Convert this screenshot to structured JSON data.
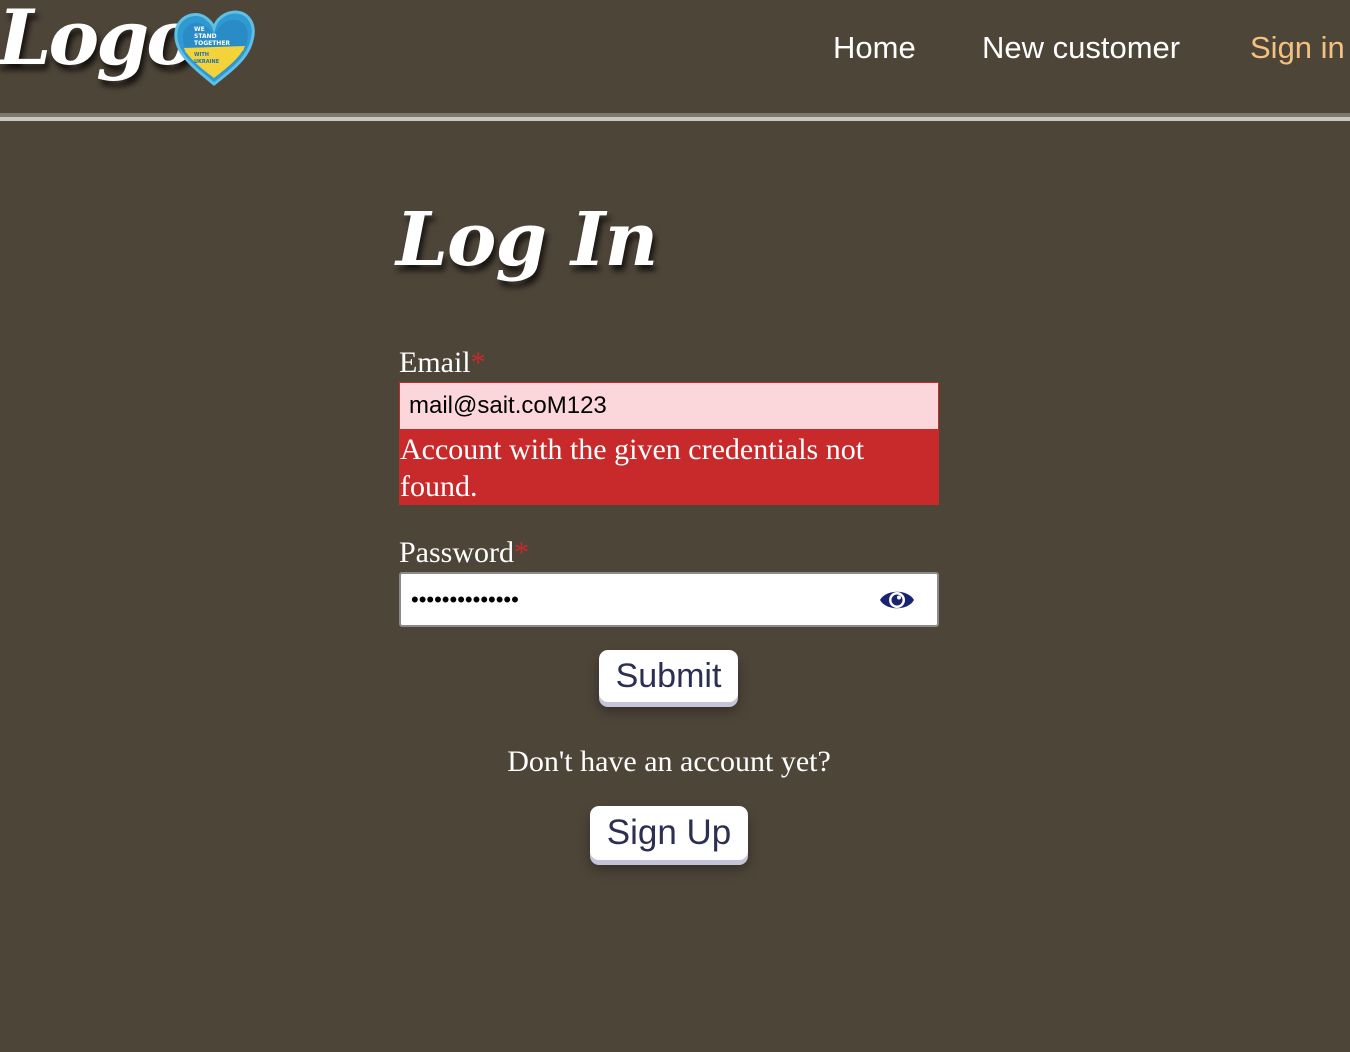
{
  "header": {
    "logo_text": "Logo",
    "badge_lines": [
      "WE",
      "STAND",
      "TOGETHER",
      "WITH",
      "UKRAINE"
    ],
    "nav": {
      "home": "Home",
      "new_customer": "New customer",
      "sign_in": "Sign in"
    },
    "active_nav_color": "#f3c180"
  },
  "form": {
    "title": "Log In",
    "email_label": "Email",
    "required_marker": "*",
    "email_value": "mail@sait.coM123",
    "error_message": "Account with the given credentials not found.",
    "password_label": "Password",
    "password_value": "••••••••••••••",
    "password_toggle_icon": "eye-icon",
    "submit_label": "Submit",
    "signup_prompt": "Don't have an account yet?",
    "signup_label": "Sign Up"
  },
  "colors": {
    "background": "#4e4539",
    "error": "#c82a2c",
    "error_field_bg": "#fbd7dc",
    "button_text": "#2c2f52",
    "eye_icon": "#1a2370"
  }
}
